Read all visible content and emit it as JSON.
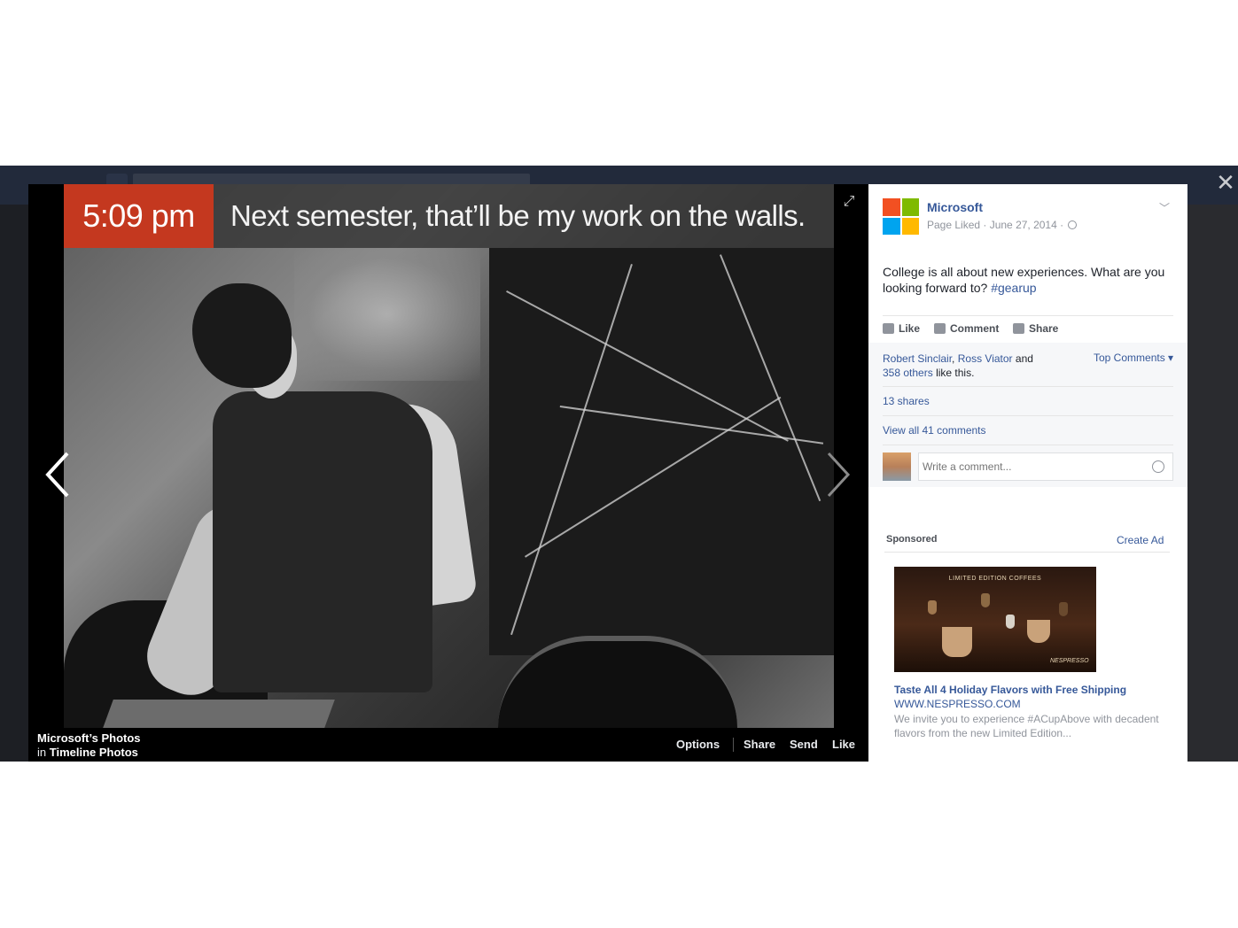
{
  "photo": {
    "time": "5:09 pm",
    "caption": "Next semester, that’ll be my work on the walls."
  },
  "footer": {
    "owner": "Microsoft’s Photos",
    "in_prefix": "in",
    "album": "Timeline Photos",
    "options": "Options",
    "share": "Share",
    "send": "Send",
    "like": "Like"
  },
  "post": {
    "page_name": "Microsoft",
    "meta": "Page Liked · June 27, 2014 ·",
    "text": "College is all about new experiences. What are you looking forward to?",
    "hashtag": "#gearup",
    "actions": {
      "like": "Like",
      "comment": "Comment",
      "share": "Share"
    },
    "likers": {
      "name1": "Robert Sinclair",
      "sep": ",",
      "name2": "Ross Viator",
      "and": "and",
      "others": "358 others",
      "suffix": "like this."
    },
    "top_comments": "Top Comments ▾",
    "shares": "13 shares",
    "view_comments": "View all 41 comments",
    "comment_placeholder": "Write a comment..."
  },
  "sponsored": {
    "label": "Sponsored",
    "create_ad": "Create Ad",
    "ad_banner": "LIMITED EDITION COFFEES",
    "ad_brand": "NESPRESSO",
    "ad_title": "Taste All 4 Holiday Flavors with Free Shipping",
    "ad_url": "WWW.NESPRESSO.COM",
    "ad_desc": "We invite you to experience #ACupAbove with decadent flavors from the new Limited Edition..."
  },
  "colors": {
    "accent_link": "#365899",
    "time_chip": "#c4381f",
    "ms_red": "#f25022",
    "ms_green": "#7fba00",
    "ms_blue": "#00a4ef",
    "ms_yellow": "#ffb900"
  },
  "icons": [
    "close-icon",
    "fullscreen-icon",
    "prev-arrow-icon",
    "next-arrow-icon",
    "globe-icon",
    "chevron-down-icon",
    "like-icon",
    "comment-icon",
    "share-icon",
    "emoji-icon"
  ]
}
